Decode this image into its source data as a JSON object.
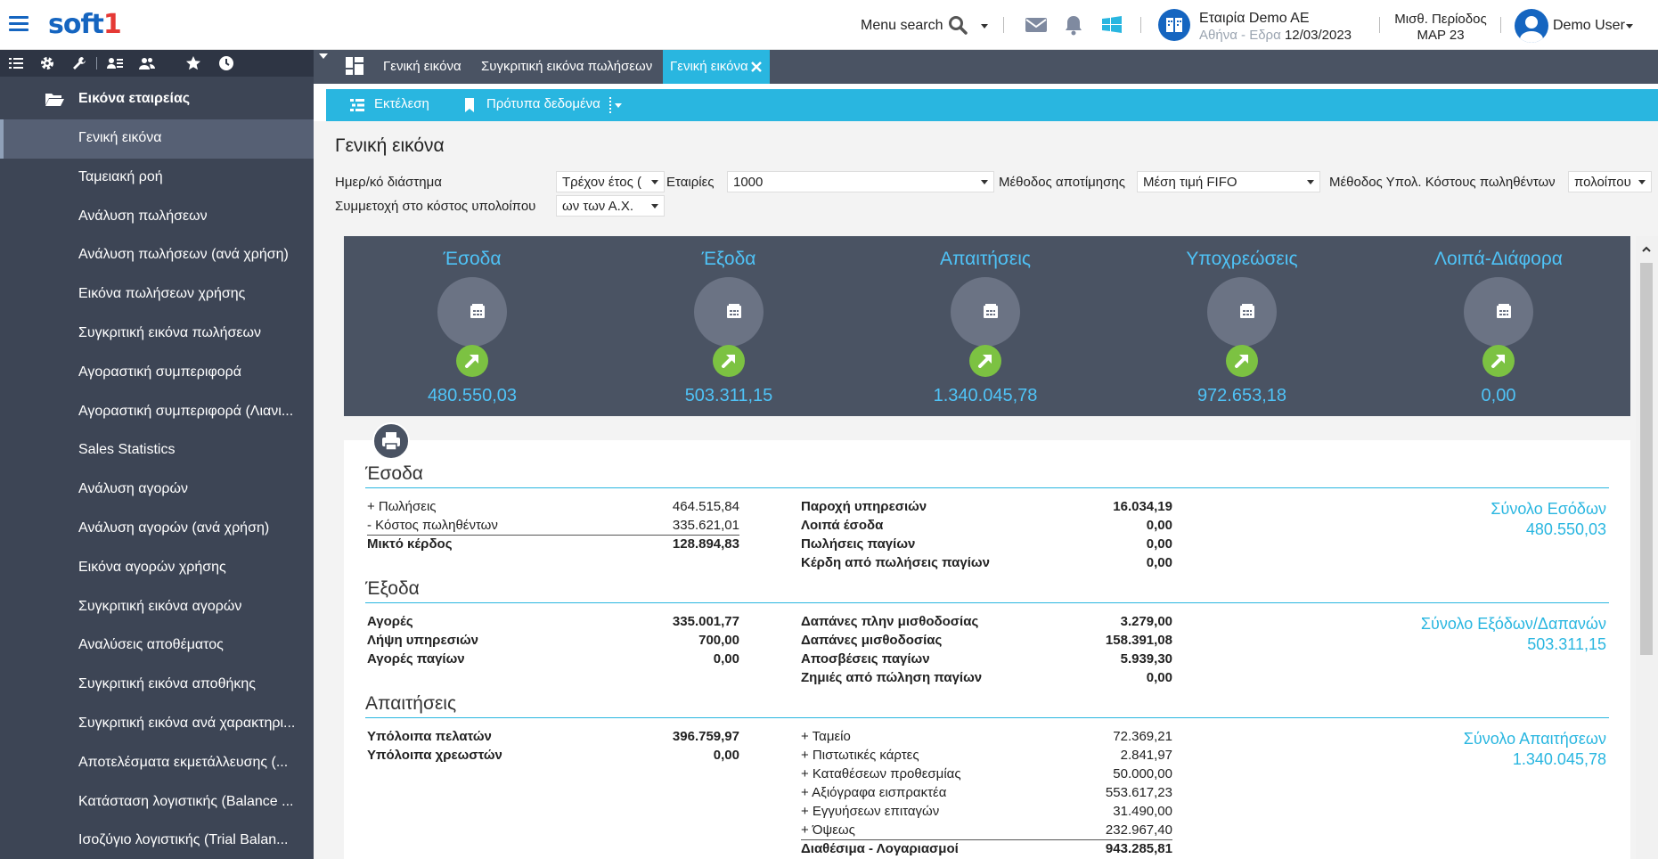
{
  "header": {
    "logo_main": "soft",
    "logo_accent": "1",
    "menu_search": "Menu search",
    "company_name": "Εταιρία Demo AE",
    "company_branch": "Αθήνα - Εδρα",
    "date": "12/03/2023",
    "period_label": "Μισθ. Περίοδος",
    "period_value": "ΜΑΡ 23",
    "user_name": "Demo User"
  },
  "sidebar": {
    "group_label": "Εικόνα εταιρείας",
    "items": [
      "Γενική εικόνα",
      "Ταμειακή ροή",
      "Ανάλυση πωλήσεων",
      "Ανάλυση πωλήσεων (ανά χρήση)",
      "Εικόνα πωλήσεων χρήσης",
      "Συγκριτική εικόνα πωλήσεων",
      "Αγοραστική συμπεριφορά",
      "Αγοραστική συμπεριφορά (Λιανι...",
      "Sales Statistics",
      "Ανάλυση αγορών",
      "Ανάλυση αγορών (ανά χρήση)",
      "Εικόνα αγορών χρήσης",
      "Συγκριτική εικόνα αγορών",
      "Αναλύσεις αποθέματος",
      "Συγκριτική εικόνα αποθήκης",
      "Συγκριτική εικόνα ανά χαρακτηρι...",
      "Αποτελέσματα εκμετάλλευσης (...",
      "Κατάσταση λογιστικής (Balance ...",
      "Ισοζύγιο λογιστικής (Trial Balan..."
    ]
  },
  "tabs": [
    "Γενική εικόνα",
    "Συγκριτική εικόνα πωλήσεων",
    "Γενική εικόνα"
  ],
  "actions": {
    "run": "Εκτέλεση",
    "templates": "Πρότυπα δεδομένα"
  },
  "page_title": "Γενική εικόνα",
  "filters": {
    "date_range_label": "Ημερ/κό διάστημα",
    "date_range_value": "Τρέχον έτος (",
    "companies_label": "Εταιρίες",
    "companies_value": "1000",
    "valuation_label": "Μέθοδος αποτίμησης",
    "valuation_value": "Μέση τιμή FIFO",
    "cost_method_label": "Μέθοδος Υπολ. Κόστους πωληθέντων",
    "cost_method_value": "πολοίπου",
    "participation_label": "Συμμετοχή στο κόστος υπολοίπου",
    "participation_value": "ων των Α.Χ."
  },
  "kpis": [
    {
      "title": "Έσοδα",
      "value": "480.550,03"
    },
    {
      "title": "Έξοδα",
      "value": "503.311,15"
    },
    {
      "title": "Απαιτήσεις",
      "value": "1.340.045,78"
    },
    {
      "title": "Υποχρεώσεις",
      "value": "972.653,18"
    },
    {
      "title": "Λοιπά-Διάφορα",
      "value": "0,00"
    }
  ],
  "income": {
    "title": "Έσοδα",
    "left": [
      {
        "label": "+ Πωλήσεις",
        "value": "464.515,84"
      },
      {
        "label": "- Κόστος πωληθέντων",
        "value": "335.621,01"
      },
      {
        "label": "Μικτό κέρδος",
        "value": "128.894,83"
      }
    ],
    "right": [
      {
        "label": "Παροχή υπηρεσιών",
        "value": "16.034,19"
      },
      {
        "label": "Λοιπά έσοδα",
        "value": "0,00"
      },
      {
        "label": "Πωλήσεις παγίων",
        "value": "0,00"
      },
      {
        "label": "Κέρδη από πωλήσεις παγίων",
        "value": "0,00"
      }
    ],
    "total_label": "Σύνολο Εσόδων",
    "total_value": "480.550,03"
  },
  "expenses": {
    "title": "Έξοδα",
    "left": [
      {
        "label": "Αγορές",
        "value": "335.001,77"
      },
      {
        "label": "Λήψη υπηρεσιών",
        "value": "700,00"
      },
      {
        "label": "Αγορές παγίων",
        "value": "0,00"
      }
    ],
    "right": [
      {
        "label": "Δαπάνες πλην μισθοδοσίας",
        "value": "3.279,00"
      },
      {
        "label": "Δαπάνες μισθοδοσίας",
        "value": "158.391,08"
      },
      {
        "label": "Αποσβέσεις παγίων",
        "value": "5.939,30"
      },
      {
        "label": "Ζημιές από πώληση παγίων",
        "value": "0,00"
      }
    ],
    "total_label": "Σύνολο Εξόδων/Δαπανών",
    "total_value": "503.311,15"
  },
  "receivables": {
    "title": "Απαιτήσεις",
    "left": [
      {
        "label": "Υπόλοιπα πελατών",
        "value": "396.759,97"
      },
      {
        "label": "Υπόλοιπα χρεωστών",
        "value": "0,00"
      }
    ],
    "right": [
      {
        "label": "+ Ταμείο",
        "value": "72.369,21"
      },
      {
        "label": "+ Πιστωτικές κάρτες",
        "value": "2.841,97"
      },
      {
        "label": "+ Καταθέσεων προθεσμίας",
        "value": "50.000,00"
      },
      {
        "label": "+ Αξιόγραφα εισπρακτέα",
        "value": "553.617,23"
      },
      {
        "label": "+ Εγγυήσεων επιταγών",
        "value": "31.490,00"
      },
      {
        "label": "+ Όψεως",
        "value": "232.967,40"
      },
      {
        "label": "Διαθέσιμα - Λογαριασμοί",
        "value": "943.285,81"
      }
    ],
    "total_label": "Σύνολο Απαιτήσεων",
    "total_value": "1.340.045,78"
  }
}
